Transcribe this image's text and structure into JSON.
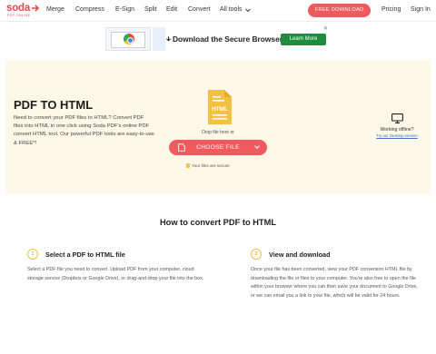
{
  "nav": {
    "logo": "soda",
    "logo_sub": "PDF ONLINE",
    "links": [
      "Merge",
      "Compress",
      "E-Sign",
      "Split",
      "Edit",
      "Convert",
      "All tools"
    ],
    "cta": "FREE DOWNLOAD",
    "pricing": "Pricing",
    "signin": "Sign In"
  },
  "ad": {
    "title": "Download the Secure Browser",
    "button": "Learn More"
  },
  "hero": {
    "title": "PDF TO HTML",
    "description": "Need to convert your PDF files to HTML? Convert PDF files into HTML in one click using Soda PDF's online PDF convert HTML tool. Our powerful PDF tools are easy-to-use & FREE*!",
    "file_badge": "HTML",
    "drop_text": "Drop file here or",
    "choose_button": "CHOOSE FILE",
    "secure_note": "Your files are secure",
    "offline_title": "Working offline?",
    "offline_link": "Try our Desktop version"
  },
  "howto": {
    "title": "How to convert PDF to HTML",
    "steps": [
      {
        "num": "1",
        "title": "Select a PDF to HTML file",
        "desc": "Select a PDF file you need to convert. Upload PDF from your computer, cloud storage service (Dropbox or Google Drive), or drag-and-drop your file into the box."
      },
      {
        "num": "2",
        "title": "View and download",
        "desc": "Once your file has been converted, view your PDF conversion HTML file by downloading the file or files to your computer. You're also free to open the file within your browser where you can then save your document to Google Drive, or we can email you a link to your file, which will be valid for 24 hours."
      }
    ]
  },
  "colors": {
    "brand": "#e8484d",
    "cta": "#ef5a5f",
    "hero_bg": "#fdf8e7",
    "file_icon": "#f3c245",
    "link": "#3b6fd6",
    "ad_button": "#1e8e3e"
  },
  "icons": {
    "file": "html-file-icon",
    "monitor": "monitor-icon",
    "lock": "lock-icon",
    "caret": "chevron-down-icon"
  }
}
